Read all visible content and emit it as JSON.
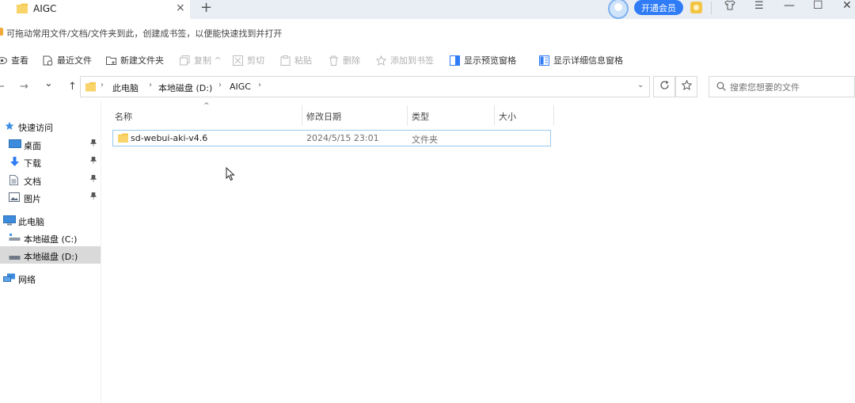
{
  "titlebar": {
    "tab_title": "AIGC",
    "close_glyph": "×",
    "new_tab_glyph": "+",
    "vip_button": "开通会员",
    "window_controls": {
      "shirt": "👕",
      "menu": "☰",
      "minimize": "—",
      "maximize": "☐",
      "close": "✕"
    }
  },
  "bookmark_bar": {
    "hint": "可拖动常用文件/文档/文件夹到此，创建成书签，以便能快速找到并打开"
  },
  "toolbar": {
    "view": "查看",
    "recent": "最近文件",
    "new_folder": "新建文件夹",
    "copy": "复制 ^",
    "cut": "剪切",
    "paste": "粘贴",
    "delete": "删除",
    "add_bookmark": "添加到书签",
    "preview_pane": "显示预览窗格",
    "details_pane": "显示详细信息窗格"
  },
  "nav": {
    "back": "←",
    "forward": "→",
    "recent": "⌄",
    "up": "↑"
  },
  "address": {
    "crumbs": [
      "此电脑",
      "本地磁盘 (D:)",
      "AIGC"
    ],
    "separator": "›",
    "dropdown": "⌄"
  },
  "search": {
    "placeholder": "搜索您想要的文件"
  },
  "sidebar": {
    "quick_access": "快速访问",
    "desktop": "桌面",
    "downloads": "下载",
    "documents": "文档",
    "pictures": "图片",
    "this_pc": "此电脑",
    "drive_c": "本地磁盘 (C:)",
    "drive_d": "本地磁盘 (D:)",
    "network": "网络",
    "pin": "📌"
  },
  "columns": {
    "name": "名称",
    "modified": "修改日期",
    "type": "类型",
    "size": "大小",
    "sort_indicator": "^"
  },
  "files": [
    {
      "name": "sd-webui-aki-v4.6",
      "modified": "2024/5/15 23:01",
      "type": "文件夹",
      "size": ""
    }
  ],
  "colors": {
    "accent": "#2f7cf6",
    "selection_border": "#99c9ef",
    "folder": "#f5c84c",
    "tab_bar": "#e9eef4"
  },
  "icons": [
    "folder-icon",
    "close-icon",
    "plus-icon",
    "avatar-icon",
    "coin-icon",
    "shirt-icon",
    "menu-icon",
    "minimize-icon",
    "maximize-icon",
    "window-close-icon",
    "eye-icon",
    "recent-file-icon",
    "new-folder-icon",
    "copy-icon",
    "cut-icon",
    "paste-icon",
    "trash-icon",
    "star-icon",
    "preview-pane-icon",
    "details-pane-icon",
    "refresh-icon",
    "search-icon",
    "desktop-icon",
    "download-icon",
    "document-icon",
    "picture-icon",
    "pc-icon",
    "drive-icon",
    "network-icon",
    "pin-icon",
    "cursor-icon"
  ]
}
